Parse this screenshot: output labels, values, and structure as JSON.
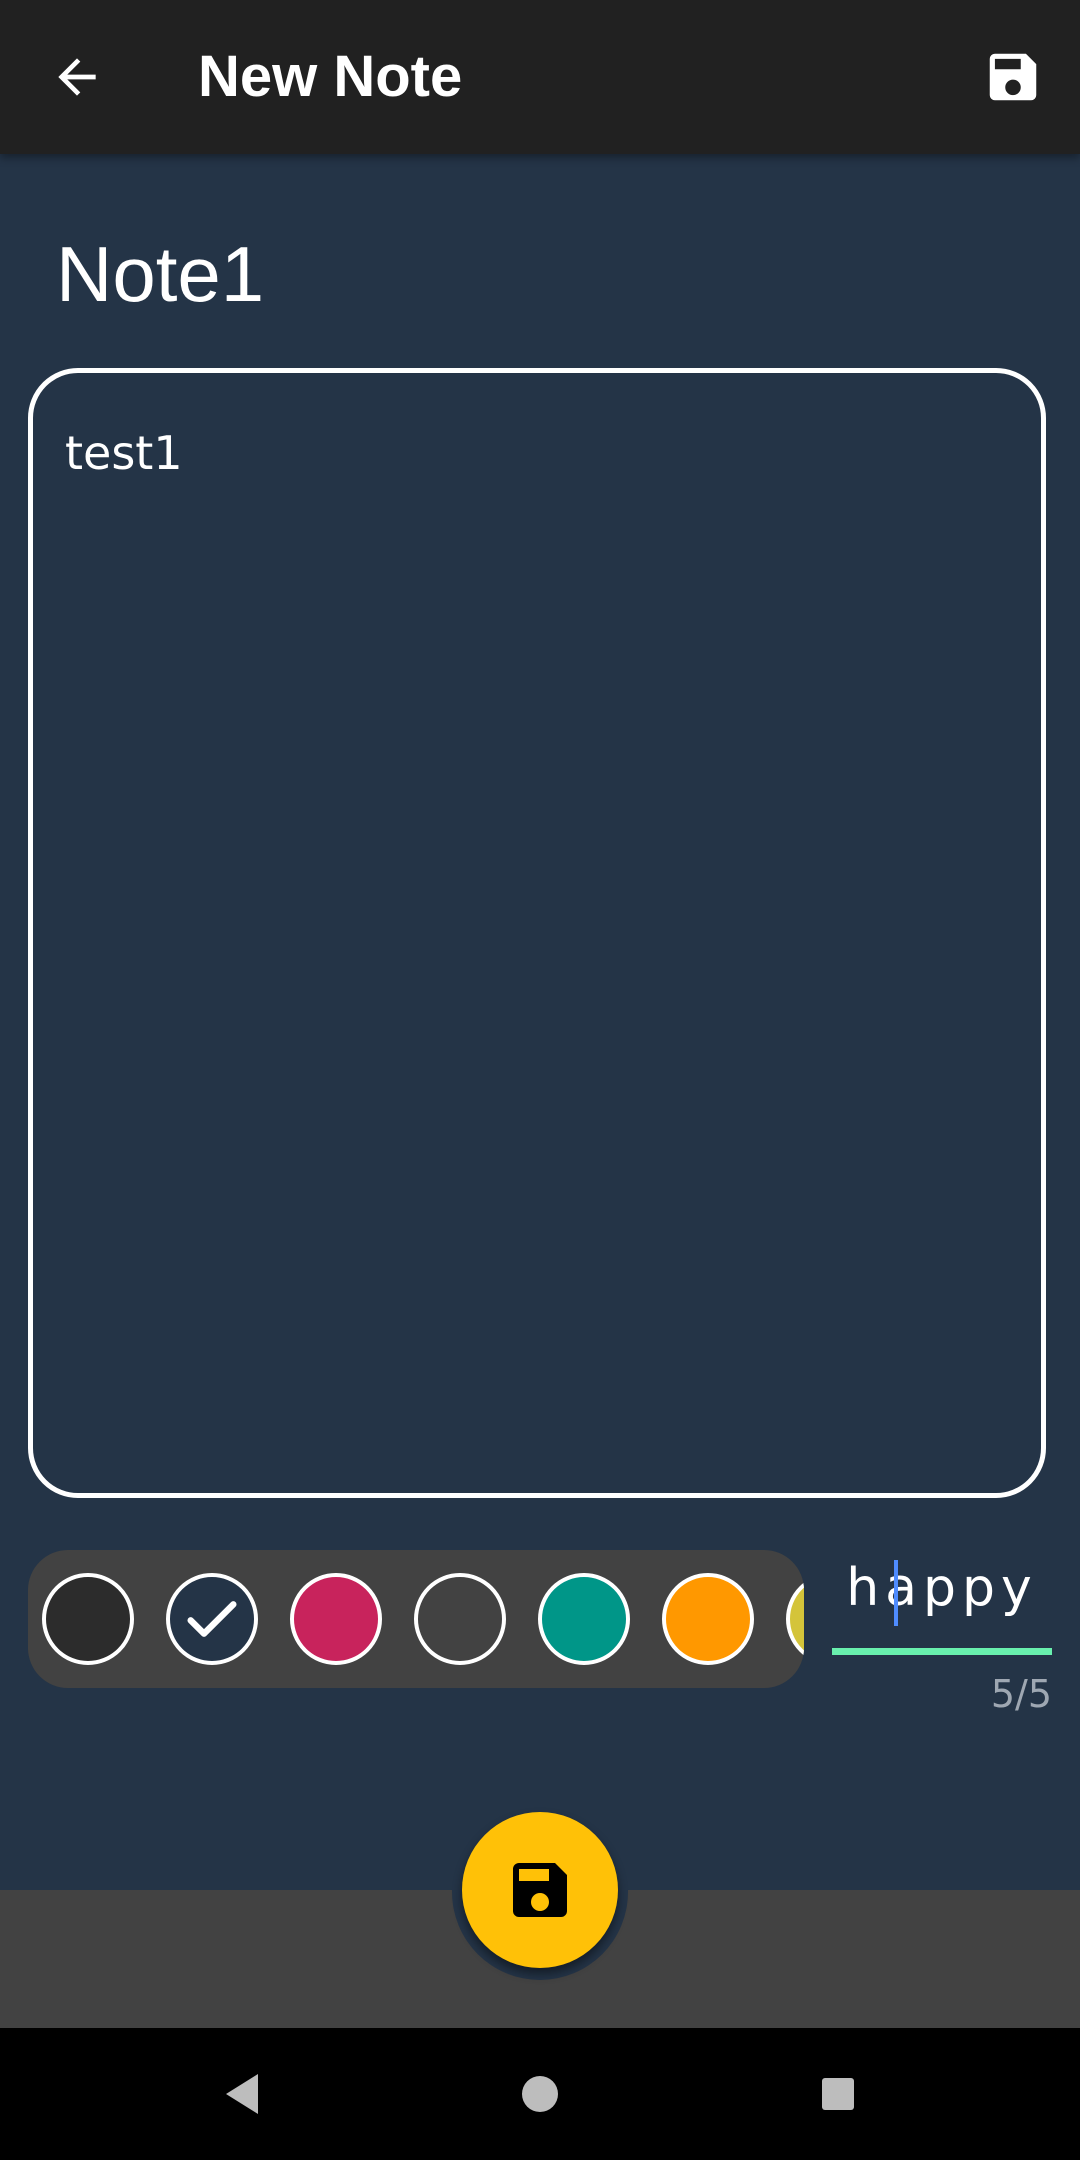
{
  "appbar": {
    "title": "New Note",
    "back_icon": "arrow-back-icon",
    "save_icon": "save-icon"
  },
  "note": {
    "title": "Note1",
    "body": "test1"
  },
  "color_picker": {
    "swatches": [
      {
        "name": "dark-gray",
        "color": "#2c2c2c",
        "selected": false
      },
      {
        "name": "navy",
        "color": "#243447",
        "selected": true
      },
      {
        "name": "pink",
        "color": "#c8235c",
        "selected": false
      },
      {
        "name": "gray",
        "color": "#424242",
        "selected": false
      },
      {
        "name": "teal",
        "color": "#009688",
        "selected": false
      },
      {
        "name": "orange",
        "color": "#ff9800",
        "selected": false
      },
      {
        "name": "yellow",
        "color": "#d4c43a",
        "selected": false
      }
    ]
  },
  "mood": {
    "value": "happy",
    "counter": "5/5",
    "underline_color": "#69f0ae"
  },
  "fab": {
    "icon": "save-icon",
    "color": "#ffc107"
  },
  "navbar": {
    "back_icon": "triangle-back-icon",
    "home_icon": "circle-home-icon",
    "recents_icon": "square-recents-icon"
  }
}
